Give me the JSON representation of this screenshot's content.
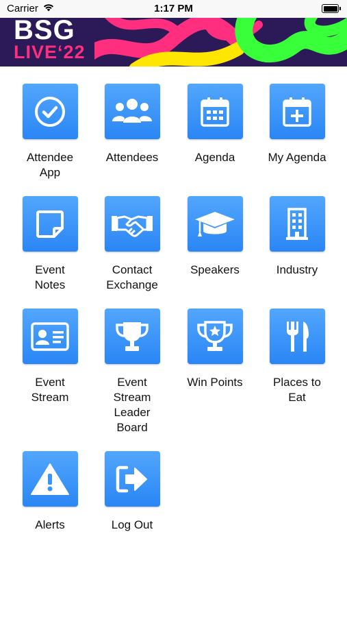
{
  "status_bar": {
    "carrier": "Carrier",
    "time": "1:17 PM"
  },
  "banner": {
    "brand_main": "BSG",
    "brand_sub": "LIVE‘22",
    "accent_color": "#ff2e7e",
    "background_color": "#2b1a57"
  },
  "menu": {
    "tile_color": "#3a95f8",
    "items": [
      {
        "label": "Attendee App",
        "icon": "check-circle-icon"
      },
      {
        "label": "Attendees",
        "icon": "people-group-icon"
      },
      {
        "label": "Agenda",
        "icon": "calendar-icon"
      },
      {
        "label": "My Agenda",
        "icon": "calendar-plus-icon"
      },
      {
        "label": "Event Notes",
        "icon": "sticky-note-icon"
      },
      {
        "label": "Contact Exchange",
        "icon": "handshake-icon"
      },
      {
        "label": "Speakers",
        "icon": "graduation-cap-icon"
      },
      {
        "label": "Industry",
        "icon": "building-icon"
      },
      {
        "label": "Event Stream",
        "icon": "id-card-icon"
      },
      {
        "label": "Event Stream Leader Board",
        "icon": "trophy-icon"
      },
      {
        "label": "Win Points",
        "icon": "star-trophy-icon"
      },
      {
        "label": "Places to Eat",
        "icon": "fork-knife-icon"
      },
      {
        "label": "Alerts",
        "icon": "warning-icon"
      },
      {
        "label": "Log Out",
        "icon": "logout-arrow-icon"
      }
    ]
  }
}
